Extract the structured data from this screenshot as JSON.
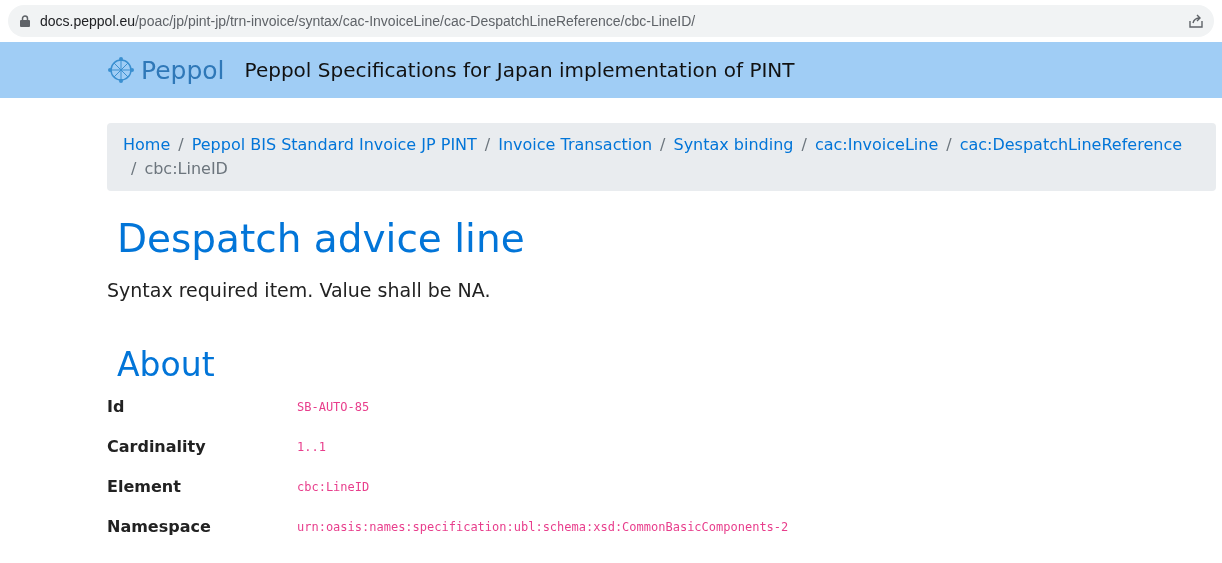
{
  "address_bar": {
    "host": "docs.peppol.eu",
    "path": "/poac/jp/pint-jp/trn-invoice/syntax/cac-InvoiceLine/cac-DespatchLineReference/cbc-LineID/"
  },
  "header": {
    "logo": "Peppol",
    "title": "Peppol Specifications for Japan implementation of PINT"
  },
  "breadcrumb": [
    {
      "label": "Home",
      "kind": "link"
    },
    {
      "separator": "/",
      "label": "Peppol BIS Standard Invoice JP PINT",
      "kind": "link"
    },
    {
      "separator": "/",
      "label": "Invoice Transaction",
      "kind": "link"
    },
    {
      "separator": "/",
      "label": "Syntax binding",
      "kind": "link"
    },
    {
      "separator": "/",
      "label": "cac:InvoiceLine",
      "kind": "link"
    },
    {
      "separator": "/",
      "label": "cac:DespatchLineReference",
      "kind": "link"
    },
    {
      "separator": "/",
      "label": "cbc:LineID",
      "kind": "current"
    }
  ],
  "heading": "Despatch advice line",
  "description": "Syntax required item. Value shall be NA.",
  "about": {
    "heading": "About",
    "rows": [
      {
        "label": "Id",
        "value": "SB-AUTO-85"
      },
      {
        "label": "Cardinality",
        "value": "1..1"
      },
      {
        "label": "Element",
        "value": "cbc:LineID"
      },
      {
        "label": "Namespace",
        "value": "urn:oasis:names:specification:ubl:schema:xsd:CommonBasicComponents-2"
      }
    ]
  }
}
